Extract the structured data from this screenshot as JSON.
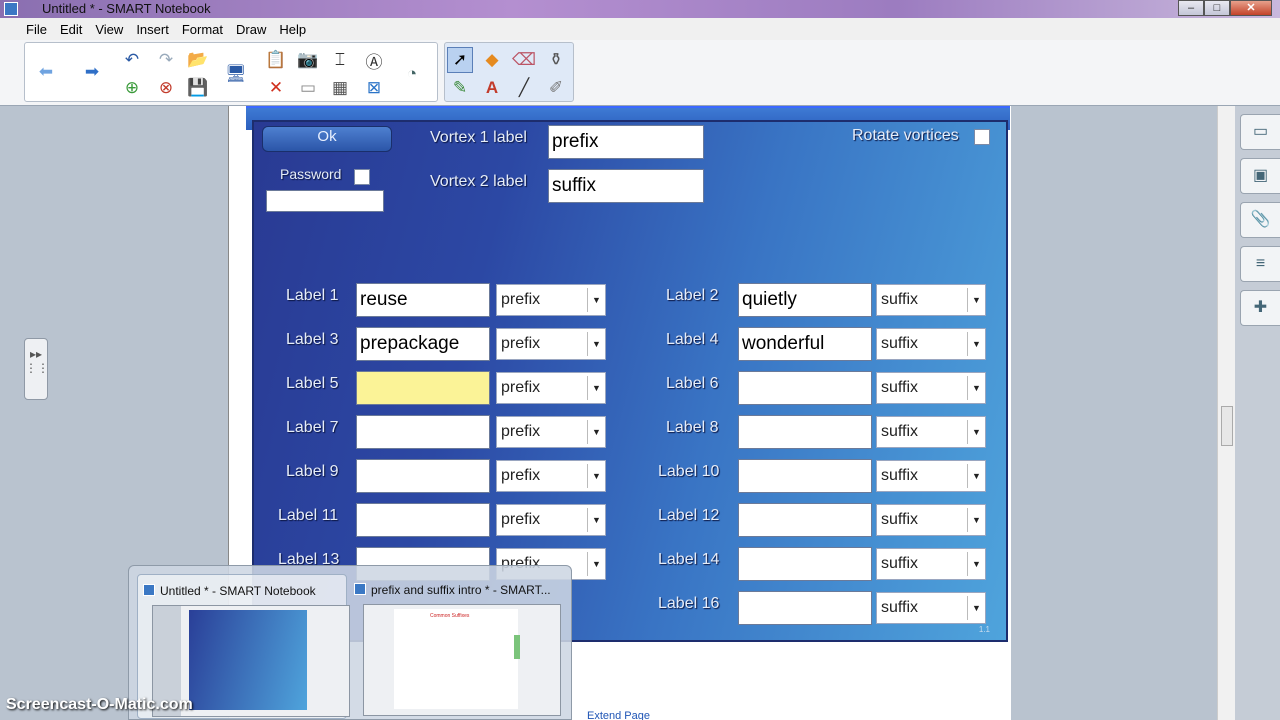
{
  "window": {
    "title": "Untitled * - SMART Notebook"
  },
  "menu": [
    "File",
    "Edit",
    "View",
    "Insert",
    "Format",
    "Draw",
    "Help"
  ],
  "widget": {
    "ok_label": "Ok",
    "password_label": "Password",
    "vortex1_label": "Vortex 1 label",
    "vortex1_value": "prefix",
    "vortex2_label": "Vortex 2 label",
    "vortex2_value": "suffix",
    "rotate_label": "Rotate vortices",
    "version": "1.1",
    "rows_left": [
      {
        "label": "Label 1",
        "value": "reuse",
        "choice": "prefix"
      },
      {
        "label": "Label 3",
        "value": "prepackage",
        "choice": "prefix"
      },
      {
        "label": "Label 5",
        "value": "",
        "choice": "prefix"
      },
      {
        "label": "Label 7",
        "value": "",
        "choice": "prefix"
      },
      {
        "label": "Label 9",
        "value": "",
        "choice": "prefix"
      },
      {
        "label": "Label 11",
        "value": "",
        "choice": "prefix"
      },
      {
        "label": "Label 13",
        "value": "",
        "choice": "prefix"
      }
    ],
    "rows_right": [
      {
        "label": "Label 2",
        "value": "quietly",
        "choice": "suffix"
      },
      {
        "label": "Label 4",
        "value": "wonderful",
        "choice": "suffix"
      },
      {
        "label": "Label 6",
        "value": "",
        "choice": "suffix"
      },
      {
        "label": "Label 8",
        "value": "",
        "choice": "suffix"
      },
      {
        "label": "Label 10",
        "value": "",
        "choice": "suffix"
      },
      {
        "label": "Label 12",
        "value": "",
        "choice": "suffix"
      },
      {
        "label": "Label 14",
        "value": "",
        "choice": "suffix"
      },
      {
        "label": "Label 16",
        "value": "",
        "choice": "suffix"
      }
    ]
  },
  "taskbar": {
    "thumb1_title": "Untitled * - SMART Notebook",
    "thumb2_title": "prefix and suffix intro * - SMART...",
    "thumb2_heading": "Common Suffixes"
  },
  "extend_page": "Extend Page",
  "watermark": "Screencast-O-Matic.com",
  "colors": {
    "highlight_field": "#fbf397",
    "widget_blue": "#2c48a4"
  }
}
